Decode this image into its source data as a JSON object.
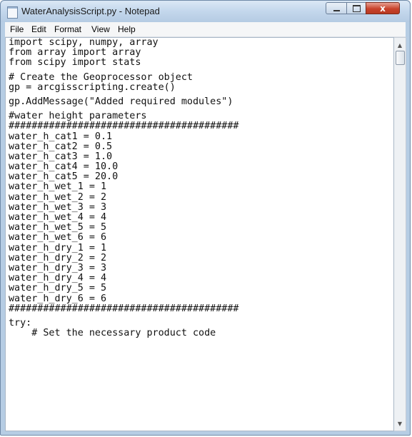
{
  "window": {
    "title": "WaterAnalysisScript.py - Notepad",
    "controls": {
      "minimize": "minimize",
      "maximize": "maximize",
      "close": "x"
    }
  },
  "menu": {
    "items": [
      "File",
      "Edit",
      "Format",
      "View",
      "Help"
    ]
  },
  "editor": {
    "lines": [
      "import scipy, numpy, array",
      "from array import array",
      "from scipy import stats",
      "",
      "# Create the Geoprocessor object",
      "gp = arcgisscripting.create()",
      "",
      "gp.AddMessage(\"Added required modules\")",
      "",
      "#water height parameters",
      "########################################",
      "water_h_cat1 = 0.1",
      "water_h_cat2 = 0.5",
      "water_h_cat3 = 1.0",
      "water_h_cat4 = 10.0",
      "water_h_cat5 = 20.0",
      "water_h_wet_1 = 1",
      "water_h_wet_2 = 2",
      "water_h_wet_3 = 3",
      "water_h_wet_4 = 4",
      "water_h_wet_5 = 5",
      "water_h_wet_6 = 6",
      "water_h_dry_1 = 1",
      "water_h_dry_2 = 2",
      "water_h_dry_3 = 3",
      "water_h_dry_4 = 4",
      "water_h_dry_5 = 5",
      "water_h_dry_6 = 6",
      "########################################",
      "",
      "try:",
      "    # Set the necessary product code"
    ]
  },
  "scrollbar": {
    "up_icon": "arrow-up-icon",
    "down_icon": "arrow-down-icon"
  }
}
